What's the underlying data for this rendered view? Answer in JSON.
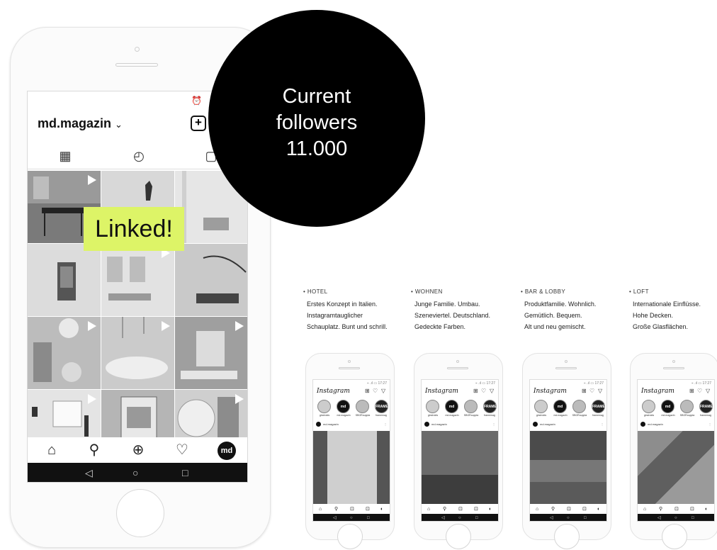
{
  "bubble": {
    "line1": "Current",
    "line2": "followers",
    "line3": "11.000"
  },
  "linked_label": "Linked!",
  "big_phone": {
    "status_icons": "⏰ ⌔ ıl",
    "username": "md.magazin",
    "username_chevron": "⌄",
    "new_post_icon": "plus-square-icon",
    "tabs": [
      {
        "icon": "grid-icon",
        "glyph": "▦"
      },
      {
        "icon": "igtv-icon",
        "glyph": "◴"
      },
      {
        "icon": "tagged-icon",
        "glyph": "▢"
      }
    ],
    "bottom_nav": [
      {
        "icon": "home-icon",
        "glyph": "⌂"
      },
      {
        "icon": "search-icon",
        "glyph": "⚲"
      },
      {
        "icon": "add-post-icon",
        "glyph": "⊕"
      },
      {
        "icon": "heart-icon",
        "glyph": "♡"
      }
    ],
    "profile_avatar_text": "md",
    "system_nav": [
      "◁",
      "○",
      "□"
    ]
  },
  "columns": [
    {
      "title": "• HOTEL",
      "lines": [
        "Erstes Konzept in Italien.",
        "Instagramtauglicher",
        "Schauplatz. Bunt und schrill."
      ]
    },
    {
      "title": "• WOHNEN",
      "lines": [
        "Junge Familie. Umbau.",
        "Szeneviertel. Deutschland.",
        "Gedeckte Farben."
      ]
    },
    {
      "title": "• BAR & LOBBY",
      "lines": [
        "Produktfamilie. Wohnlich.",
        "Gemütlich. Bequem.",
        "Alt und neu gemischt."
      ]
    },
    {
      "title": "• LOFT",
      "lines": [
        "Internationale Einflüsse.",
        "Hohe Decken.",
        "Große Glasflächen."
      ]
    }
  ],
  "small_phone": {
    "app_name": "Instagram",
    "status": "⌁ .ıl ▭ 17:27",
    "header_icons": [
      "⊞",
      "♡",
      "▽"
    ],
    "stories": [
      {
        "text": "",
        "label": "gindroids"
      },
      {
        "text": "md",
        "label": "md.magazin"
      },
      {
        "text": "",
        "label": "SBGRouppla"
      },
      {
        "text": "FRAME",
        "label": "framemag"
      }
    ],
    "account": "md.magazin",
    "account_menu": "⋮",
    "nav": [
      "⌂",
      "⚲",
      "⊡",
      "⊡",
      "◐"
    ],
    "sys": [
      "◁",
      "○",
      "□"
    ]
  },
  "colors": {
    "linked_bg": "#ddf467",
    "bubble_bg": "#000000"
  }
}
